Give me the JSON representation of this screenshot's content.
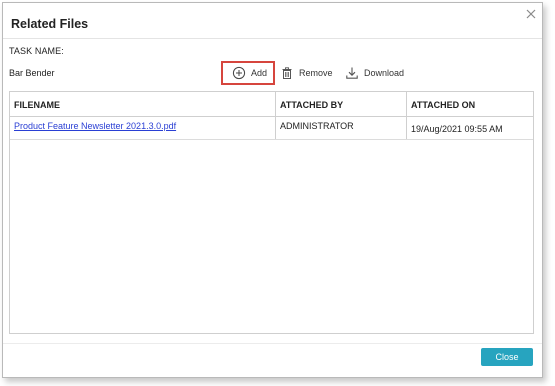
{
  "dialog": {
    "title": "Related Files"
  },
  "task": {
    "label": "TASK NAME:",
    "value": "Bar Bender"
  },
  "toolbar": {
    "add_label": "Add",
    "add_icon": "plus-circle-icon",
    "remove_label": "Remove",
    "remove_icon": "trash-icon",
    "download_label": "Download",
    "download_icon": "download-icon",
    "highlight_color": "#d6453d"
  },
  "table": {
    "columns": [
      "FILENAME",
      "ATTACHED BY",
      "ATTACHED ON"
    ],
    "rows": [
      {
        "filename": "Product Feature Newsletter 2021.3.0.pdf",
        "attached_by": "ADMINISTRATOR",
        "attached_on": "19/Aug/2021 09:55 AM"
      }
    ]
  },
  "footer": {
    "close_label": "Close",
    "close_color": "#27a4bf"
  }
}
